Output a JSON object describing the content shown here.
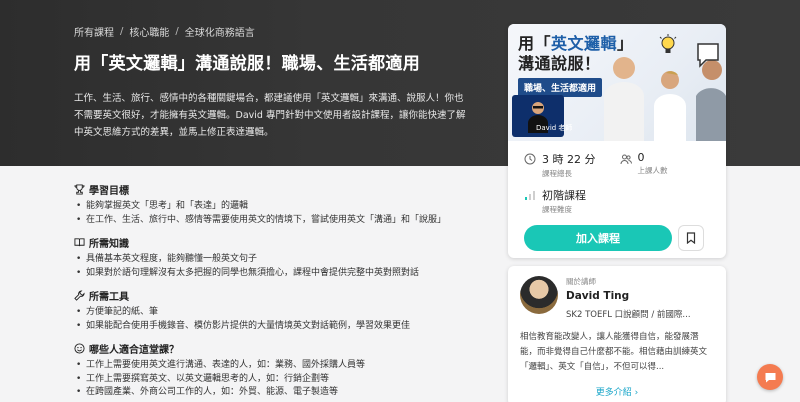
{
  "breadcrumb": [
    "所有課程",
    "核心職能",
    "全球化商務語言"
  ],
  "breadcrumb_sep": "/",
  "course": {
    "title": "用「英文邏輯」溝通說服！職場、生活都適用",
    "description": "工作、生活、旅行、感情中的各種關鍵場合，都建議使用「英文邏輯」來溝通、說服人！你也不需要英文很好，才能擁有英文邏輯。David 專門針對中文使用者設計課程，讓你能快速了解中英文思維方式的差異，並馬上修正表達邏輯。"
  },
  "sections": [
    {
      "title": "學習目標",
      "icon": "trophy-icon",
      "items": [
        "能夠掌握英文「思考」和「表達」的邏輯",
        "在工作、生活、旅行中、感情等需要使用英文的情境下，嘗試使用英文「溝通」和「說服」"
      ]
    },
    {
      "title": "所需知識",
      "icon": "book-icon",
      "items": [
        "具備基本英文程度，能夠聽懂一般英文句子",
        "如果對於語句理解沒有太多把握的同學也無須擔心，課程中會提供完整中英對照對話"
      ]
    },
    {
      "title": "所需工具",
      "icon": "wrench-icon",
      "items": [
        "方便筆記的紙、筆",
        "如果能配合使用手機錄音、模仿影片提供的大量情境英文對話範例，學習效果更佳"
      ]
    },
    {
      "title": "哪些人適合這堂課？",
      "icon": "smile-icon",
      "items": [
        "工作上需要使用英文進行溝通、表達的人，如：業務、國外採購人員等",
        "工作上需要撰寫英文、以英文邏輯思考的人，如：行銷企劃等",
        "在跨國產業、外商公司工作的人，如：外貿、能源、電子製造等"
      ]
    }
  ],
  "thumbnail": {
    "line1_a": "用「",
    "line1_b": "英文邏輯",
    "line1_c": "」",
    "line2": "溝通說服！",
    "tag": "職場、生活都適用",
    "badge": "David 老師"
  },
  "stats": {
    "duration_value": "3 時 22 分",
    "duration_label": "課程總長",
    "students_value": "0",
    "students_label": "上課人數",
    "level_value": "初階課程",
    "level_label": "課程難度"
  },
  "join_label": "加入課程",
  "teacher": {
    "about_label": "關於講師",
    "name": "David Ting",
    "role": "SK2 TOEFL 口說顧問 / 前國際...",
    "bio": "相信教育能改變人，讓人能獲得自信，能發展潛能，而非覺得自己什麼都不能。相信藉由訓練英文「邏輯」、英文「自信」，不但可以得...",
    "more_label": "更多介紹",
    "more_arrow": "›"
  },
  "colors": {
    "accent": "#1ac7b6",
    "link": "#1aa6c9",
    "chat": "#f47b50"
  }
}
